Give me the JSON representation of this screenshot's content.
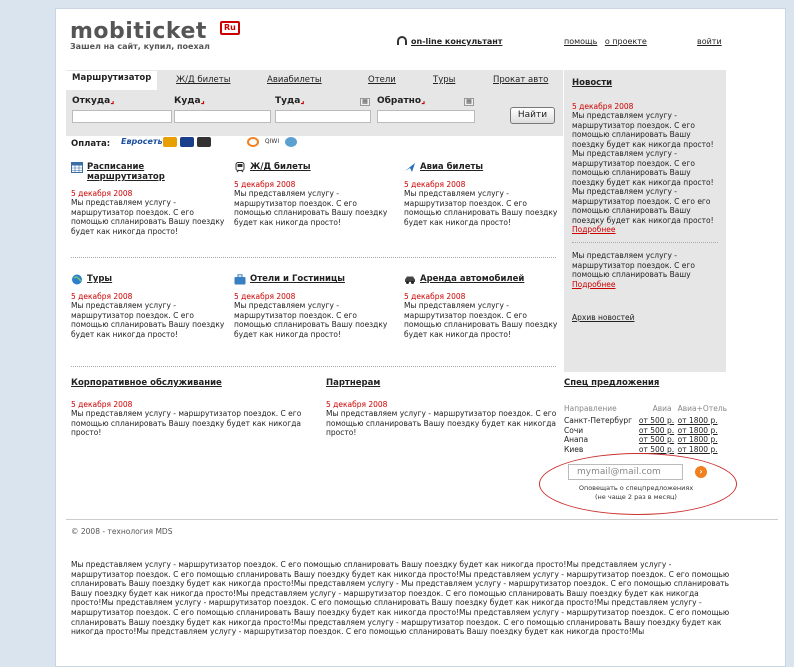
{
  "header": {
    "logo_text": "mobiticket",
    "logo_badge": "Ru",
    "slogan": "Зашел на сайт, купил, поехал",
    "consultant": "on-line консультант",
    "help": "помощь",
    "about": "о проекте",
    "login": "войти"
  },
  "search": {
    "tabs": [
      "Маршрутизатор",
      "Ж/Д билеты",
      "Авиабилеты",
      "Отели",
      "Туры",
      "Прокат авто"
    ],
    "from_label": "Откуда",
    "where_label": "Куда",
    "to_label": "Туда",
    "back_label": "Обратно",
    "find_button": "Найти"
  },
  "payment": {
    "label": "Оплата:",
    "methods": [
      "Евросеть",
      "MasterCard",
      "Visa",
      "Maestro",
      "Kiwi",
      "QIWI",
      "Webmoney"
    ]
  },
  "services": [
    {
      "title_line1": "Расписание",
      "title_line2": "маршрутизатор",
      "icon": "calendar-icon",
      "date": "5 декабря 2008",
      "text": "Мы представляем услугу - маршрутизатор поездок. С его помощью спланировать Вашу поездку будет как никогда просто!"
    },
    {
      "title_line1": "Ж/Д билеты",
      "title_line2": "",
      "icon": "train-icon",
      "date": "5 декабря 2008",
      "text": "Мы представляем услугу - маршрутизатор поездок. С его помощью спланировать Вашу поездку будет как никогда просто!"
    },
    {
      "title_line1": "Авиа билеты",
      "title_line2": "",
      "icon": "plane-icon",
      "date": "5 декабря 2008",
      "text": "Мы представляем услугу - маршрутизатор поездок. С его помощью спланировать Вашу поездку будет как никогда просто!"
    },
    {
      "title_line1": "Туры",
      "title_line2": "",
      "icon": "globe-icon",
      "date": "5 декабря 2008",
      "text": "Мы представляем услугу - маршрутизатор поездок. С его помощью спланировать Вашу поездку будет как никогда просто!"
    },
    {
      "title_line1": "Отели и Гостиницы",
      "title_line2": "",
      "icon": "suitcase-icon",
      "date": "5 декабря 2008",
      "text": "Мы представляем услугу - маршрутизатор поездок. С его помощью спланировать Вашу поездку будет как никогда просто!"
    },
    {
      "title_line1": "Аренда автомобилей",
      "title_line2": "",
      "icon": "car-icon",
      "date": "5 декабря 2008",
      "text": "Мы представляем услугу - маршрутизатор поездок. С его помощью спланировать Вашу поездку будет как никогда просто!"
    }
  ],
  "news": {
    "title": "Новости",
    "item1_date": "5 декабря 2008",
    "item1_text": "Мы представляем услугу - маршрутизатор поездок. С его помощью спланировать Вашу поездку будет как никогда просто!Мы представляем услугу - маршрутизатор поездок. С его помощью спланировать Вашу поездку будет как никогда просто!Мы представляем услугу - маршрутизатор поездок. С его его помощью спланировать Вашу поездку будет как никогда просто!",
    "item1_more": "Подробнее",
    "item2_text": "Мы представляем услугу - маршрутизатор поездок. С его помощью спланировать Вашу",
    "item2_more": "Подробнее",
    "archive": "Архив новостей"
  },
  "corporate": {
    "title": "Корпоративное обслуживание",
    "date": "5 декабря 2008",
    "text": "Мы представляем услугу - маршрутизатор поездок. С его помощью спланировать Вашу поездку будет как никогда просто!"
  },
  "partners": {
    "title": "Партнерам",
    "date": "5 декабря 2008",
    "text": "Мы представляем услугу - маршрутизатор поездок. С его помощью спланировать Вашу поездку будет как никогда просто!"
  },
  "specials": {
    "title": "Спец предложения",
    "headers": [
      "Направление",
      "Авиа",
      "Авиа+Отель"
    ],
    "rows": [
      [
        "Санкт-Петербург",
        "от 500 р.",
        "от 1800 р."
      ],
      [
        "Сочи",
        "от 500 р.",
        "от 1800 р."
      ],
      [
        "Анапа",
        "от 500 р.",
        "от 1800 р."
      ],
      [
        "Киев",
        "от 500 р.",
        "от 1800 р."
      ]
    ],
    "email_placeholder": "mymail@mail.com",
    "note_line1": "Оповещать о спецпредложениях",
    "note_line2": "(не чаще 2 раз в месяц)"
  },
  "footer": {
    "copyright": "© 2008 - технология MDS",
    "text": "Мы представляем услугу - маршрутизатор поездок. С его помощью спланировать Вашу поездку будет как никогда просто!Мы представляем услугу - маршрутизатор поездок. С его помощью спланировать Вашу поездку будет как никогда просто!Мы представляем услугу - маршрутизатор поездок. С его помощью спланировать Вашу поездку будет как никогда просто!Мы представляем услугу - Мы представляем услугу - маршрутизатор поездок. С его помощью спланировать Вашу поездку будет как никогда просто!Мы представляем услугу - маршрутизатор поездок. С его помощью спланировать Вашу поездку будет как никогда просто!Мы представляем услугу - маршрутизатор поездок. С его помощью спланировать Вашу поездку будет как никогда просто!Мы представляем услугу - маршрутизатор поездок. С его помощью спланировать Вашу поездку будет как никогда просто!Мы представляем услугу - маршрутизатор поездок. С его помощью спланировать Вашу поездку будет как никогда просто!Мы представляем услугу - маршрутизатор поездок. С его помощью спланировать Вашу поездку будет как никогда просто!Мы представляем услугу - маршрутизатор поездок. С его помощью спланировать Вашу поездку будет как никогда просто!Мы"
  },
  "colors": {
    "accent_red": "#cc0000",
    "panel_gray": "#e6e6e6",
    "page_bg": "#d9e4ee"
  }
}
